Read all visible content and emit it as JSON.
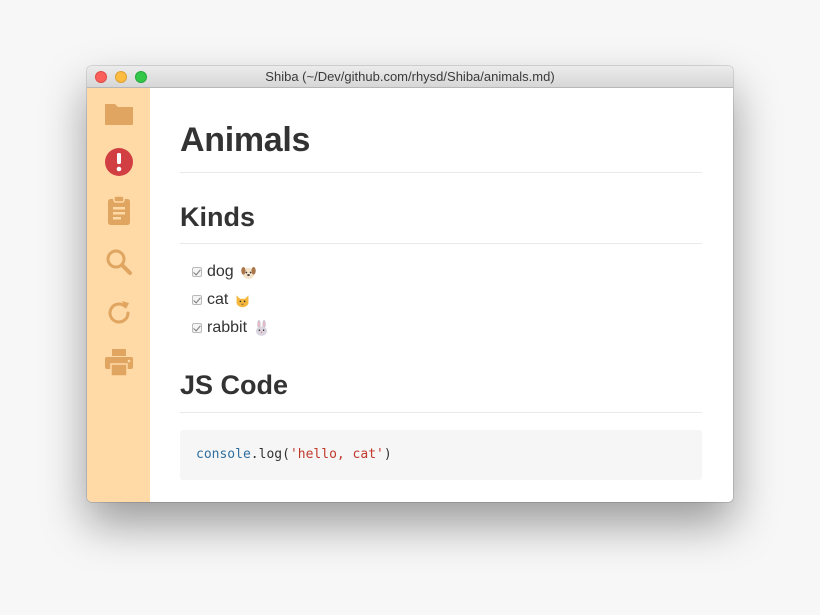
{
  "window": {
    "title": "Shiba (~/Dev/github.com/rhysd/Shiba/animals.md)"
  },
  "sidebar": {
    "items": [
      {
        "name": "open-folder",
        "icon": "folder-icon",
        "color": "#e0a560"
      },
      {
        "name": "lint-status",
        "icon": "exclamation-circle-icon",
        "color": "#d13f42"
      },
      {
        "name": "outline",
        "icon": "clipboard-icon",
        "color": "#e0a560"
      },
      {
        "name": "search",
        "icon": "search-icon",
        "color": "#e0a560"
      },
      {
        "name": "reload",
        "icon": "reload-icon",
        "color": "#e0a560"
      },
      {
        "name": "print",
        "icon": "printer-icon",
        "color": "#e0a560"
      }
    ],
    "background": "#ffdaa6"
  },
  "document": {
    "title": "Animals",
    "kinds_heading": "Kinds",
    "tasks": [
      {
        "label": "dog",
        "checked": true,
        "emoji": "dog-face-icon"
      },
      {
        "label": "cat",
        "checked": true,
        "emoji": "cat-face-icon"
      },
      {
        "label": "rabbit",
        "checked": true,
        "emoji": "rabbit-face-icon"
      }
    ],
    "code_heading": "JS Code",
    "code": {
      "object": "console",
      "method": ".log(",
      "string": "'hello, cat'",
      "close": ")"
    }
  }
}
